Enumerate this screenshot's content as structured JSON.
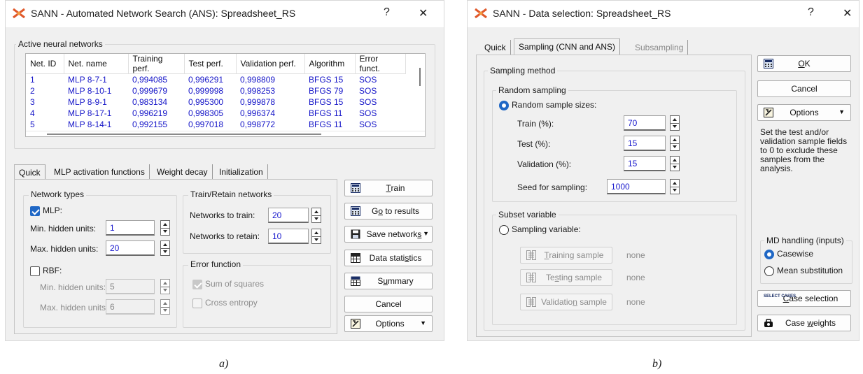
{
  "left_window": {
    "title": "SANN - Automated Network Search (ANS): Spreadsheet_RS",
    "help": "?",
    "close": "✕",
    "networks_group": "Active neural networks",
    "columns": [
      "Net. ID",
      "Net. name",
      "Training perf.",
      "Test perf.",
      "Validation perf.",
      "Algorithm",
      "Error funct."
    ],
    "rows": [
      [
        "1",
        "MLP 8-7-1",
        "0,994085",
        "0,996291",
        "0,998809",
        "BFGS 15",
        "SOS"
      ],
      [
        "2",
        "MLP 8-10-1",
        "0,999679",
        "0,999998",
        "0,998253",
        "BFGS 79",
        "SOS"
      ],
      [
        "3",
        "MLP 8-9-1",
        "0,983134",
        "0,995300",
        "0,999878",
        "BFGS 15",
        "SOS"
      ],
      [
        "4",
        "MLP 8-17-1",
        "0,996219",
        "0,998305",
        "0,996374",
        "BFGS 11",
        "SOS"
      ],
      [
        "5",
        "MLP 8-14-1",
        "0,992155",
        "0,997018",
        "0,998772",
        "BFGS 11",
        "SOS"
      ]
    ],
    "tabs": [
      "Quick",
      "MLP activation functions",
      "Weight decay",
      "Initialization"
    ],
    "network_types": {
      "group": "Network types",
      "mlp_label": "MLP:",
      "mlp_checked": true,
      "min_hidden_label": "Min. hidden units:",
      "min_hidden": "1",
      "max_hidden_label": "Max. hidden units:",
      "max_hidden": "20",
      "rbf_label": "RBF:",
      "rbf_checked": false,
      "rbf_min_label": "Min. hidden units:",
      "rbf_min": "5",
      "rbf_max_label": "Max. hidden units:",
      "rbf_max": "6"
    },
    "train_retain": {
      "group": "Train/Retain networks",
      "train_label": "Networks to train:",
      "train": "20",
      "retain_label": "Networks to retain:",
      "retain": "10"
    },
    "error_function": {
      "group": "Error function",
      "sos_label": "Sum of squares",
      "ce_label": "Cross entropy"
    },
    "buttons": {
      "train_u": "T",
      "train_rest": "rain",
      "results_pre": "G",
      "results_u": "o",
      "results_rest": " to results",
      "save_pre": "Save network",
      "save_u": "s",
      "stats_pre": "Data stati",
      "stats_u": "s",
      "stats_rest": "tics",
      "summary_pre": "S",
      "summary_u": "u",
      "summary_rest": "mmary",
      "cancel": "Cancel",
      "options": "Options"
    },
    "caption": "a)"
  },
  "right_window": {
    "title": "SANN - Data selection: Spreadsheet_RS",
    "help": "?",
    "close": "✕",
    "tabs": [
      "Quick",
      "Sampling (CNN and ANS)",
      "Subsampling"
    ],
    "sampling_method_group": "Sampling method",
    "random_sampling_group": "Random sampling",
    "random_sizes_label": "Random sample sizes:",
    "train_label": "Train (%):",
    "train": "70",
    "test_label": "Test (%):",
    "test": "15",
    "validation_label": "Validation (%):",
    "validation": "15",
    "seed_label": "Seed for sampling:",
    "seed": "1000",
    "subset_group": "Subset variable",
    "sampling_variable_label": "Sampling variable:",
    "training_sample_pre": "",
    "training_sample_u": "T",
    "training_sample_rest": "raining sample",
    "testing_sample_pre": "Te",
    "testing_sample_u": "s",
    "testing_sample_rest": "ting sample",
    "validation_sample_pre": "Validatio",
    "validation_sample_u": "n",
    "validation_sample_rest": " sample",
    "none1": "none",
    "none2": "none",
    "none3": "none",
    "ok_u": "O",
    "ok_rest": "K",
    "cancel": "Cancel",
    "options": "Options",
    "info": "Set the test and/or validation sample fields to 0 to exclude these samples from the analysis.",
    "md_group": "MD handling (inputs)",
    "casewise": "Casewise",
    "mean_sub": "Mean substitution",
    "case_sel_u": "C",
    "case_sel_rest": "ase selection",
    "case_w_pre": "Case ",
    "case_w_u": "w",
    "case_w_rest": "eights",
    "select_cases_icon_text": "SELECT CASES",
    "caption": "b)"
  }
}
